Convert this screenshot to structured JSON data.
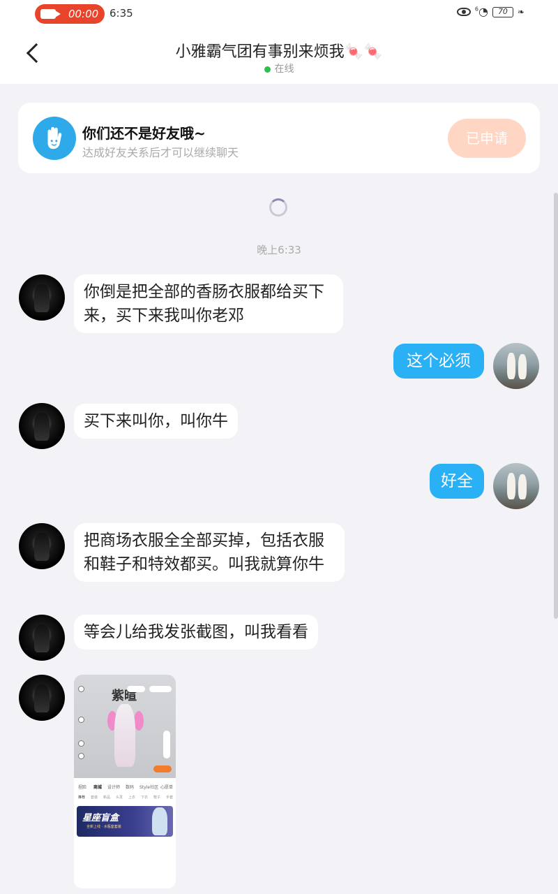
{
  "status_bar": {
    "record_time": "00:00",
    "clock": "6:35",
    "battery": "70",
    "signal_label": "6"
  },
  "header": {
    "title": "小雅霸气团有事别来烦我🍬🍬",
    "presence": "在线"
  },
  "friend_notice": {
    "title": "你们还不是好友哦~",
    "subtitle": "达成好友关系后才可以继续聊天",
    "button": "已申请"
  },
  "timestamp": "晚上6:33",
  "messages": [
    {
      "side": "in",
      "text": "你倒是把全部的香肠衣服都给买下来，买下来我叫你老邓"
    },
    {
      "side": "out",
      "text": "这个必须"
    },
    {
      "side": "in",
      "text": "买下来叫你，叫你牛"
    },
    {
      "side": "out",
      "text": "好全"
    },
    {
      "side": "in",
      "text": "把商场衣服全全部买掉，包括衣服和鞋子和特效都买。叫我就算你牛"
    },
    {
      "side": "in",
      "text": "等会儿给我发张截图，叫我看看"
    }
  ],
  "image_message": {
    "name": "紫暄",
    "tabs": [
      "捏脸",
      "商城",
      "设计师",
      "数码",
      "Style社区",
      "心愿单"
    ],
    "subtabs": [
      "推荐",
      "套装",
      "新品",
      "头发",
      "上衣",
      "下衣",
      "鞋子",
      "手套"
    ],
    "banner_title": "星座盲盒",
    "banner_sub": "全新上线 · 水瓶座套装"
  }
}
